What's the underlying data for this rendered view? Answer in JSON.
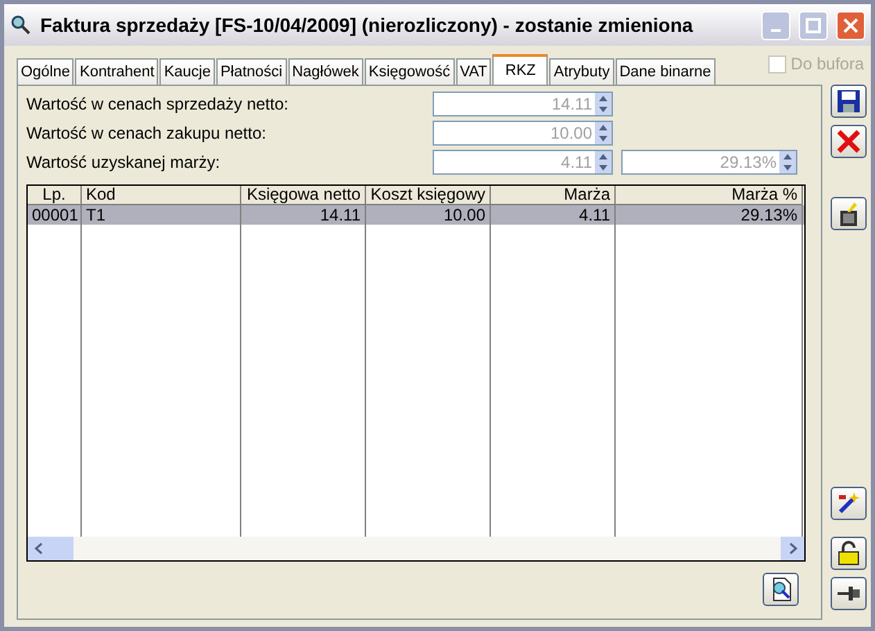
{
  "window": {
    "title": "Faktura sprzedaży [FS-10/04/2009] (nierozliczony) - zostanie zmieniona"
  },
  "tabs": [
    {
      "label": "Ogólne",
      "selected": false
    },
    {
      "label": "Kontrahent",
      "selected": false
    },
    {
      "label": "Kaucje",
      "selected": false
    },
    {
      "label": "Płatności",
      "selected": false
    },
    {
      "label": "Nagłówek",
      "selected": false
    },
    {
      "label": "Księgowość",
      "selected": false
    },
    {
      "label": "VAT",
      "selected": false
    },
    {
      "label": "RKZ",
      "selected": true
    },
    {
      "label": "Atrybuty",
      "selected": false
    },
    {
      "label": "Dane binarne",
      "selected": false
    }
  ],
  "buffer_checkbox": {
    "label": "Do bufora",
    "checked": false,
    "disabled": true
  },
  "fields": [
    {
      "label": "Wartość w cenach sprzedaży netto:",
      "values": [
        "14.11"
      ]
    },
    {
      "label": "Wartość w cenach zakupu netto:",
      "values": [
        "10.00"
      ]
    },
    {
      "label": "Wartość uzyskanej marży:",
      "values": [
        "4.11",
        "29.13%"
      ]
    }
  ],
  "table": {
    "columns": [
      "Lp.",
      "Kod",
      "Księgowa netto",
      "Koszt księgowy",
      "Marża",
      "Marża %"
    ],
    "rows": [
      {
        "cells": [
          "00001",
          "T1",
          "14.11",
          "10.00",
          "4.11",
          "29.13%"
        ],
        "selected": true
      }
    ]
  },
  "side_buttons": [
    {
      "kind": "save"
    },
    {
      "kind": "cancel"
    },
    {
      "kind": "bin"
    },
    {
      "kind": "wand"
    },
    {
      "kind": "lock"
    },
    {
      "kind": "pin"
    }
  ]
}
